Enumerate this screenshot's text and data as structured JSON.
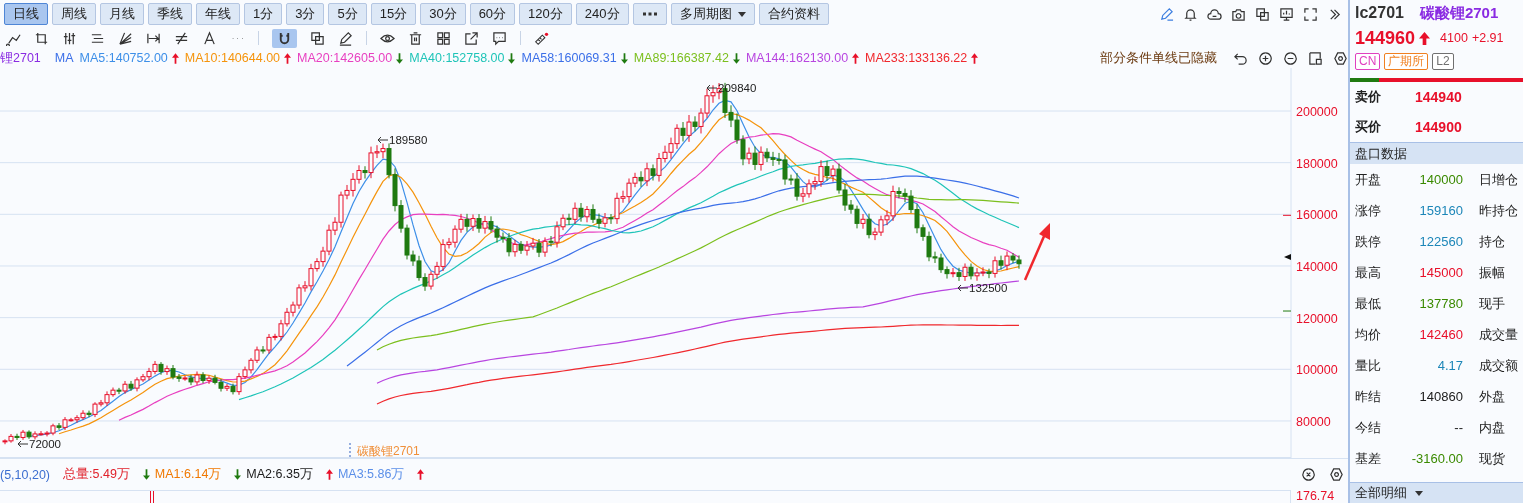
{
  "period_tabs": [
    {
      "label": "日线",
      "selected": true
    },
    {
      "label": "周线",
      "selected": false
    },
    {
      "label": "月线",
      "selected": false
    },
    {
      "label": "季线",
      "selected": false
    },
    {
      "label": "年线",
      "selected": false
    },
    {
      "label": "1分",
      "selected": false
    },
    {
      "label": "3分",
      "selected": false
    },
    {
      "label": "5分",
      "selected": false
    },
    {
      "label": "15分",
      "selected": false
    },
    {
      "label": "30分",
      "selected": false
    },
    {
      "label": "60分",
      "selected": false
    },
    {
      "label": "120分",
      "selected": false
    },
    {
      "label": "240分",
      "selected": false
    }
  ],
  "multi_period_dropdown": "多周期图",
  "contract_info_button": "合约资料",
  "magnet_tool": {
    "selected": true
  },
  "ma_legend": {
    "symbol": "锂2701",
    "label": "MA",
    "items": [
      {
        "text": "MA5:140752.00",
        "color": "#3d8fe8",
        "rising": true
      },
      {
        "text": "MA10:140644.00",
        "color": "#f5940c",
        "rising": true
      },
      {
        "text": "MA20:142605.00",
        "color": "#e83fc0",
        "rising": false
      },
      {
        "text": "MA40:152758.00",
        "color": "#1fc4b8",
        "rising": false
      },
      {
        "text": "MA58:160069.31",
        "color": "#3b6fe8",
        "rising": false
      },
      {
        "text": "MA89:166387.42",
        "color": "#7cbf1e",
        "rising": false
      },
      {
        "text": "MA144:162130.00",
        "color": "#b845e0",
        "rising": true
      },
      {
        "text": "MA233:133136.22",
        "color": "#f0282d",
        "rising": true
      }
    ]
  },
  "hidden_notice": "部分条件单线已隐藏",
  "chart": {
    "y_axis_labels": [
      "200000",
      "180000",
      "160000",
      "140000",
      "120000",
      "100000",
      "80000"
    ],
    "annotations": [
      {
        "text": "209840"
      },
      {
        "text": "189580"
      },
      {
        "text": "132500"
      },
      {
        "text": "72000"
      }
    ],
    "contract_label": "碳酸锂2701"
  },
  "volume_legend": {
    "items": [
      {
        "text": "(5,10,20)",
        "color": "#3d6fd0"
      },
      {
        "text": "总量:5.49万",
        "color": "#e0202a",
        "rising": false
      },
      {
        "text": "MA1:6.14万",
        "color": "#f07800",
        "rising": false
      },
      {
        "text": "MA2:6.35万",
        "color": "#202020",
        "rising": true
      },
      {
        "text": "MA3:5.86万",
        "color": "#5b8fe8",
        "rising": true
      }
    ]
  },
  "volume_axis_label": "176.74",
  "quote": {
    "code": "lc2701",
    "name": "碳酸锂2701",
    "price": "144960",
    "rising": true,
    "change": "4100",
    "change_pct": "+2.91",
    "tags": [
      {
        "text": "CN",
        "color": "#e040c0"
      },
      {
        "text": "广期所",
        "color": "#f08020"
      },
      {
        "text": "L2",
        "color": "#707070"
      }
    ],
    "ratio_bar": {
      "level": 0.17
    },
    "bid_ask": [
      {
        "label": "卖价",
        "value": "144940"
      },
      {
        "label": "买价",
        "value": "144900"
      }
    ],
    "section_title": "盘口数据",
    "rows": [
      {
        "label": "开盘",
        "value": "140000",
        "color": "#3a8a00",
        "right_label": "日增仓"
      },
      {
        "label": "涨停",
        "value": "159160",
        "color": "#1c86b8",
        "right_label": "昨持仓"
      },
      {
        "label": "跌停",
        "value": "122560",
        "color": "#1c86b8",
        "right_label": "持仓"
      },
      {
        "label": "最高",
        "value": "145000",
        "color": "#e8102a",
        "right_label": "振幅"
      },
      {
        "label": "最低",
        "value": "137780",
        "color": "#3a8a00",
        "right_label": "现手"
      },
      {
        "label": "均价",
        "value": "142460",
        "color": "#e8102a",
        "right_label": "成交量"
      },
      {
        "label": "量比",
        "value": "4.17",
        "color": "#1c86b8",
        "right_label": "成交额"
      },
      {
        "label": "昨结",
        "value": "140860",
        "color": "#202020",
        "right_label": "外盘"
      },
      {
        "label": "今结",
        "value": "--",
        "right_label": "内盘"
      },
      {
        "label": "基差",
        "value": "-3160.00",
        "color": "#3a8a00",
        "right_label": "现货"
      }
    ],
    "footer": "全部明细"
  }
}
